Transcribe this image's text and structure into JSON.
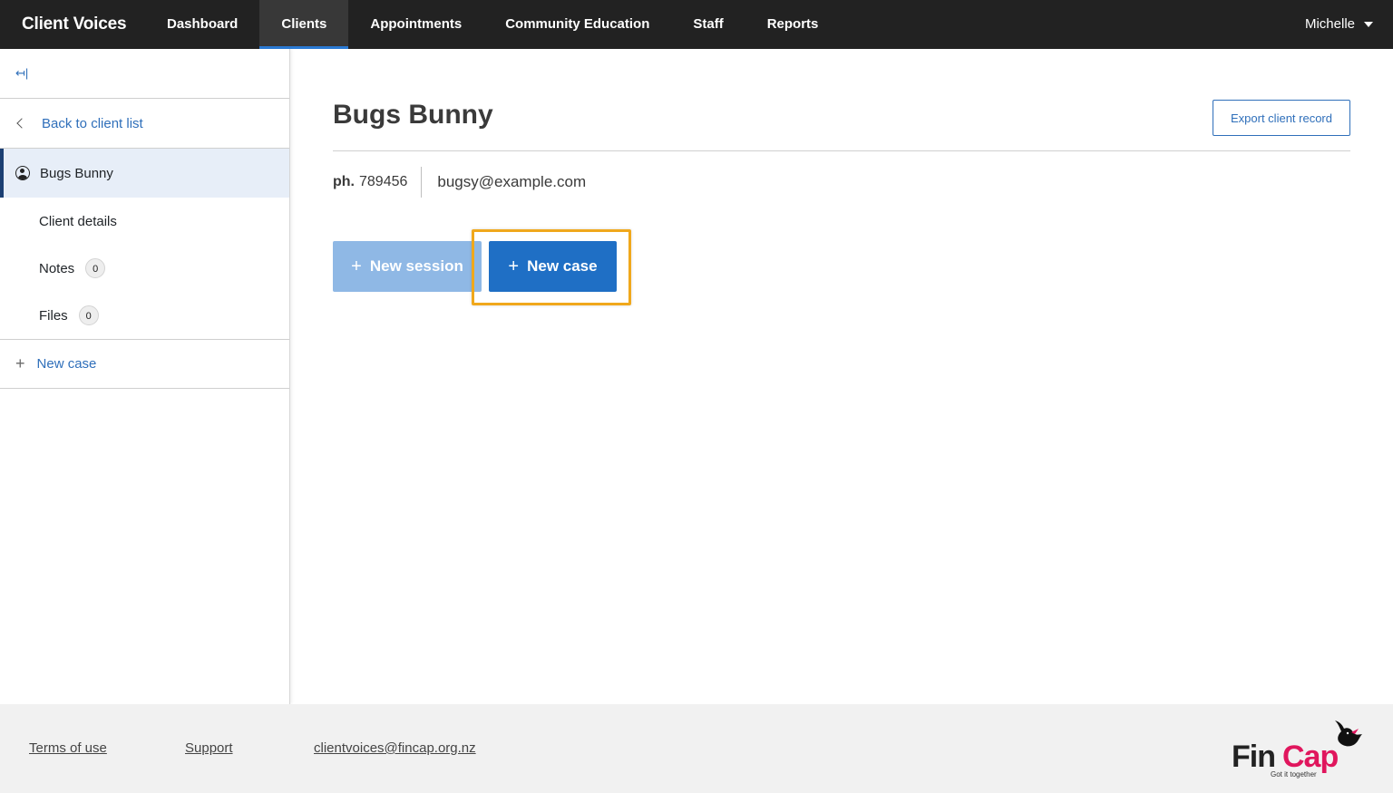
{
  "app": {
    "brand": "Client Voices",
    "user": "Michelle"
  },
  "nav": {
    "dashboard": "Dashboard",
    "clients": "Clients",
    "appointments": "Appointments",
    "community_education": "Community Education",
    "staff": "Staff",
    "reports": "Reports"
  },
  "sidebar": {
    "collapse_icon": "↤|",
    "back": "Back to client list",
    "client_name": "Bugs Bunny",
    "client_details": "Client details",
    "notes": "Notes",
    "notes_count": "0",
    "files": "Files",
    "files_count": "0",
    "new_case": "New case"
  },
  "main": {
    "title": "Bugs Bunny",
    "export": "Export client record",
    "phone_label": "ph.",
    "phone": "789456",
    "email": "bugsy@example.com",
    "new_session": "New session",
    "new_case": "New case"
  },
  "footer": {
    "terms": "Terms of use",
    "support": "Support",
    "email": "clientvoices@fincap.org.nz",
    "logo_text": "FinCap",
    "tagline": "Got it together"
  },
  "colors": {
    "accent": "#1f6fc5",
    "highlight": "#f0a81c",
    "logo_pink": "#e0165d",
    "navbar": "#222222"
  }
}
